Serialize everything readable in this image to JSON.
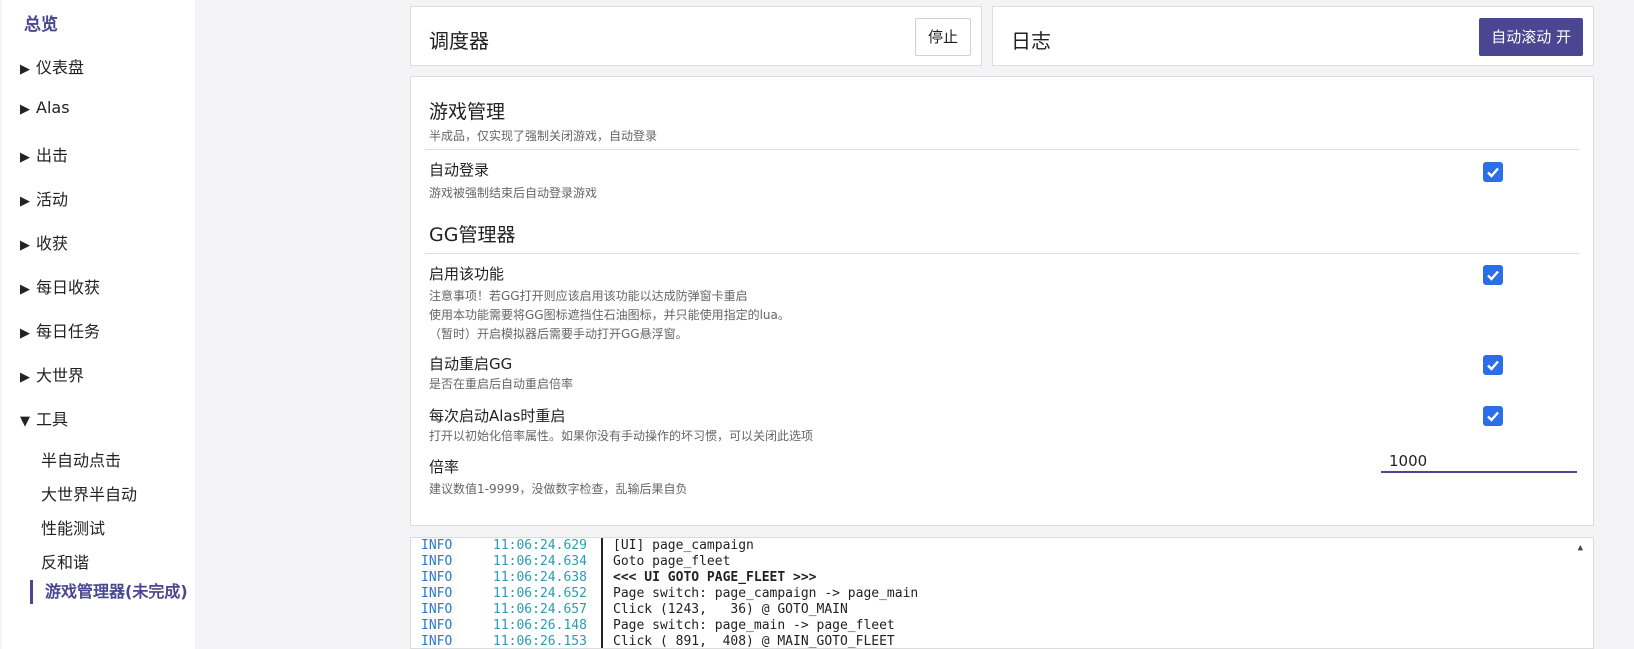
{
  "sidebar": {
    "header": "总览",
    "items": [
      {
        "arrow": "▶",
        "label": "仪表盘"
      },
      {
        "arrow": "▶",
        "label": "Alas"
      },
      {
        "arrow": "▶",
        "label": "出击"
      },
      {
        "arrow": "▶",
        "label": "活动"
      },
      {
        "arrow": "▶",
        "label": "收获"
      },
      {
        "arrow": "▶",
        "label": "每日收获"
      },
      {
        "arrow": "▶",
        "label": "每日任务"
      },
      {
        "arrow": "▶",
        "label": "大世界"
      },
      {
        "arrow": "▼",
        "label": "工具"
      }
    ],
    "subitems": [
      "半自动点击",
      "大世界半自动",
      "性能测试",
      "反和谐"
    ],
    "active": "游戏管理器(未完成)"
  },
  "scheduler": {
    "title": "调度器",
    "stop_label": "停止"
  },
  "log_panel": {
    "title": "日志",
    "autoscroll_label": "自动滚动 开"
  },
  "game_mgmt": {
    "title": "游戏管理",
    "desc": "半成品，仅实现了强制关闭游戏，自动登录",
    "auto_login": {
      "label": "自动登录",
      "help": "游戏被强制结束后自动登录游戏",
      "checked": true
    }
  },
  "gg_mgmt": {
    "title": "GG管理器",
    "enable": {
      "label": "启用该功能",
      "help": [
        "注意事项！若GG打开则应该启用该功能以达成防弹窗卡重启",
        "使用本功能需要将GG图标遮挡住石油图标，并只能使用指定的lua。",
        "（暂时）开启模拟器后需要手动打开GG悬浮窗。"
      ],
      "checked": true
    },
    "auto_restart": {
      "label": "自动重启GG",
      "help": "是否在重启后自动重启倍率",
      "checked": true
    },
    "restart_on_alas": {
      "label": "每次启动Alas时重启",
      "help": "打开以初始化倍率属性。如果你没有手动操作的坏习惯，可以关闭此选项",
      "checked": true
    },
    "rate": {
      "label": "倍率",
      "help": "建议数值1-9999，没做数字检查，乱输后果自负",
      "value": "1000"
    }
  },
  "log": [
    {
      "level": "INFO",
      "time": "11:06:24.629",
      "msg": "[UI] page_campaign",
      "bold": false
    },
    {
      "level": "INFO",
      "time": "11:06:24.634",
      "msg": "Goto page_fleet",
      "bold": false
    },
    {
      "level": "INFO",
      "time": "11:06:24.638",
      "msg": "<<< UI GOTO PAGE_FLEET >>>",
      "bold": true
    },
    {
      "level": "INFO",
      "time": "11:06:24.652",
      "msg": "Page switch: page_campaign -> page_main",
      "bold": false
    },
    {
      "level": "INFO",
      "time": "11:06:24.657",
      "msg": "Click (1243,   36) @ GOTO_MAIN",
      "bold": false
    },
    {
      "level": "INFO",
      "time": "11:06:26.148",
      "msg": "Page switch: page_main -> page_fleet",
      "bold": false
    },
    {
      "level": "INFO",
      "time": "11:06:26.153",
      "msg": "Click ( 891,  408) @ MAIN_GOTO_FLEET",
      "bold": false
    }
  ],
  "colors": {
    "accent": "#4b4691",
    "checkbox": "#2c6ee8",
    "log_level": "#2a78c9",
    "log_time": "#2a9bb3"
  }
}
